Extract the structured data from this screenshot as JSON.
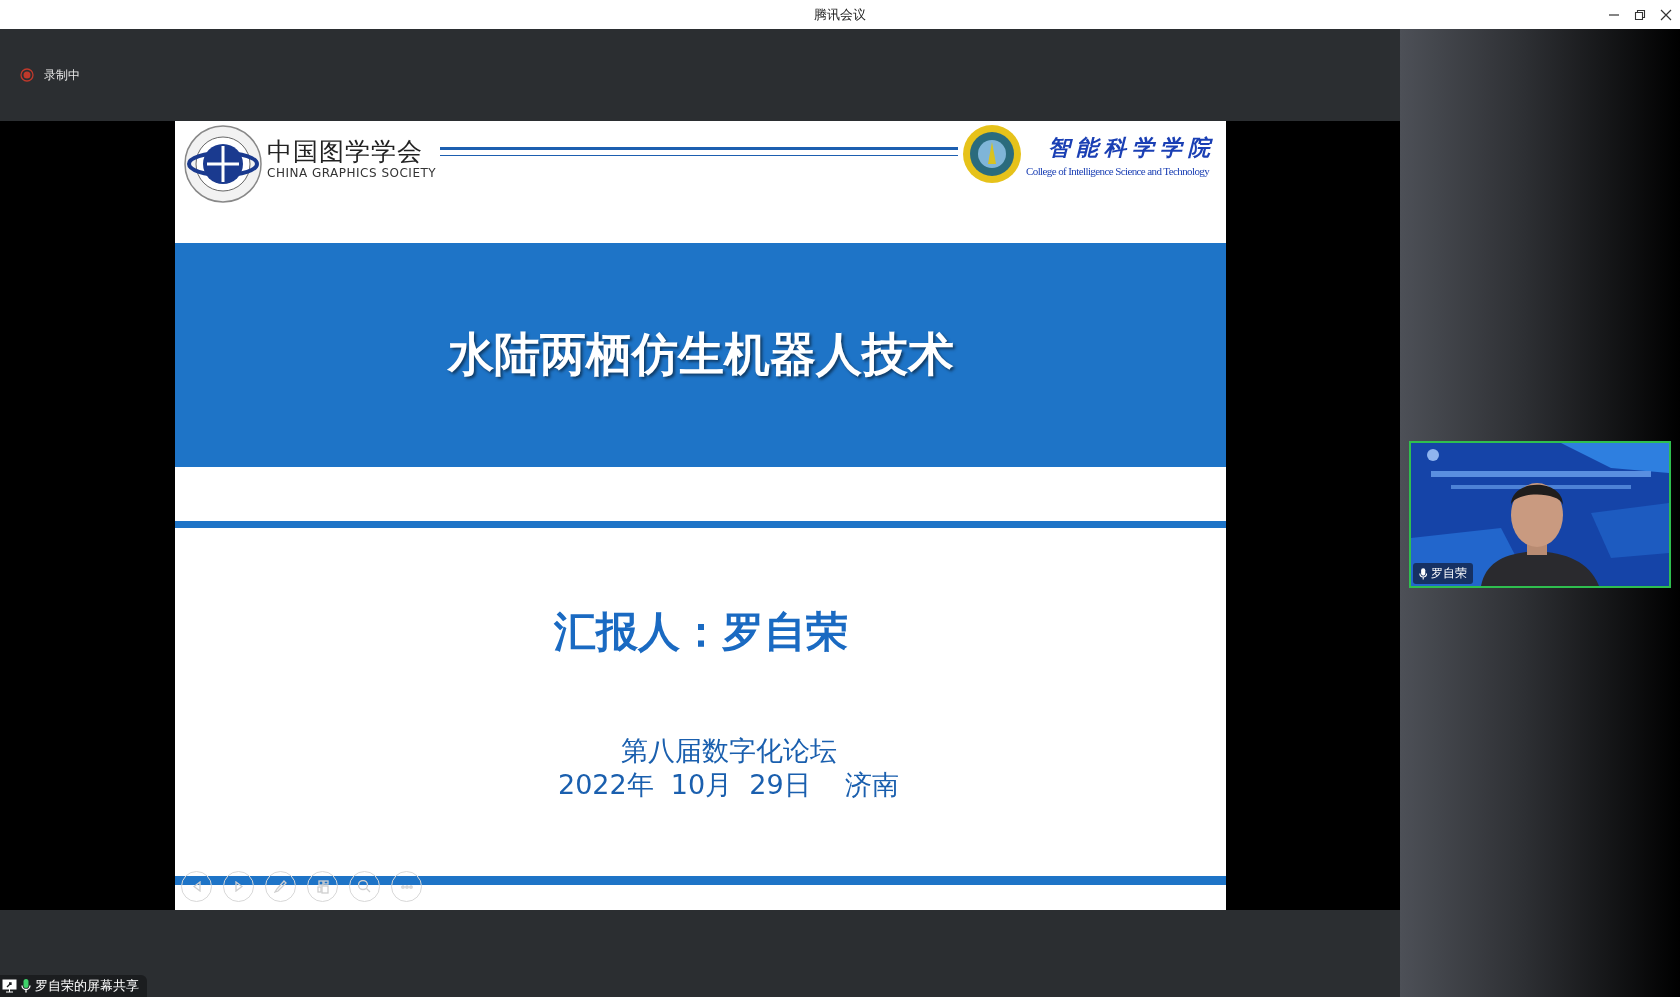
{
  "window": {
    "title": "腾讯会议"
  },
  "recording": {
    "label": "录制中"
  },
  "slide": {
    "header": {
      "left_logo": {
        "name_cn": "中国图学学会",
        "name_en": "CHINA GRAPHICS SOCIETY"
      },
      "right_logo": {
        "name_cn": "智能科学学院",
        "name_en": "College of Intelligence Science and Technology"
      }
    },
    "title": "水陆两栖仿生机器人技术",
    "presenter": "汇报人：罗自荣",
    "event": "第八届数字化论坛",
    "date_place": "2022年  10月  29日    济南"
  },
  "slide_controls": [
    {
      "kind": "prev"
    },
    {
      "kind": "next"
    },
    {
      "kind": "pen"
    },
    {
      "kind": "layout"
    },
    {
      "kind": "zoom"
    },
    {
      "kind": "more"
    }
  ],
  "video": {
    "name": "罗自荣",
    "speaking": true
  },
  "share_label": {
    "text": "罗自荣的屏幕共享"
  }
}
